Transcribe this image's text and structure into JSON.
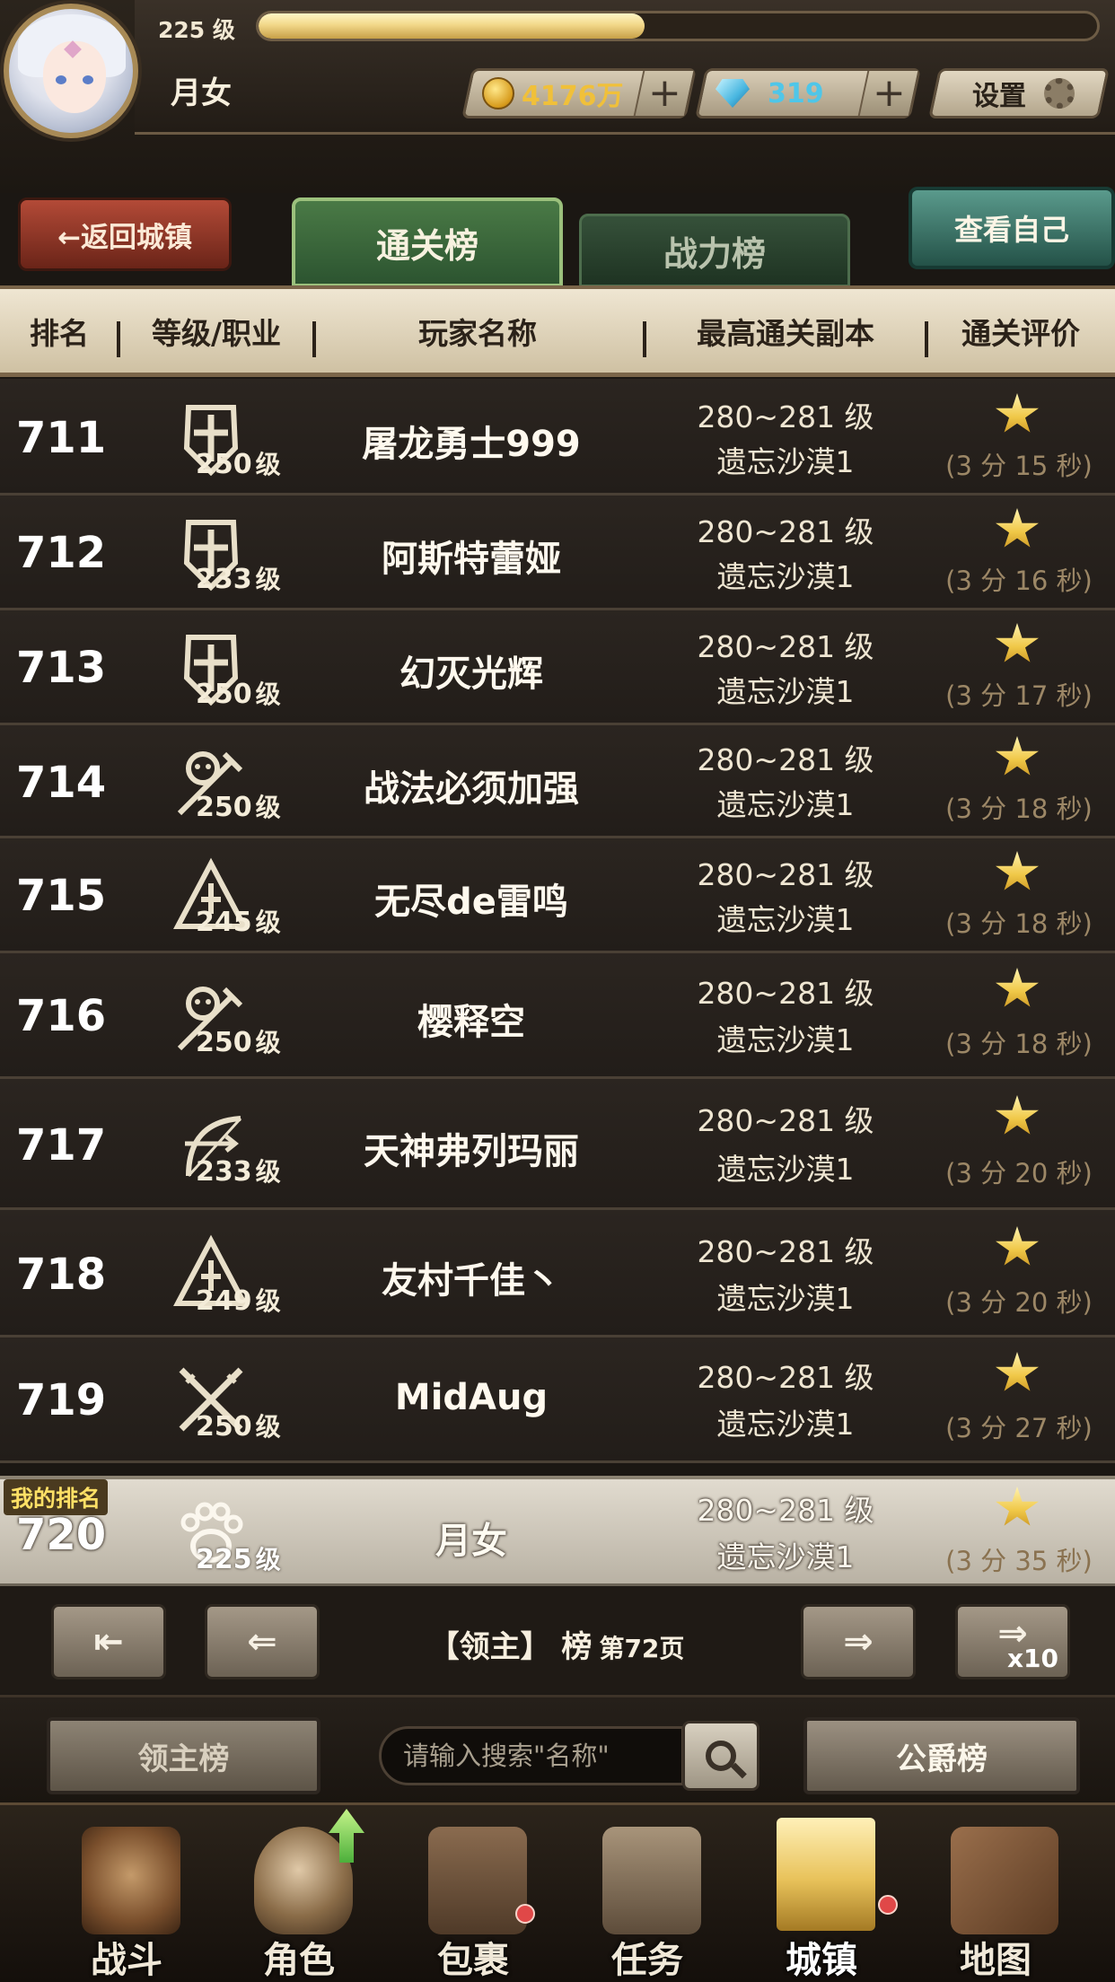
{
  "player": {
    "level_label": "225 级",
    "name": "月女",
    "exp_fraction": 0.46
  },
  "currency": {
    "gold": "4176万",
    "diamonds": "319"
  },
  "settings_label": "设置",
  "tabs": {
    "back": "←返回城镇",
    "clear_board": "通关榜",
    "power_board": "战力榜",
    "view_self": "查看自己"
  },
  "columns": {
    "rank": "排名",
    "level_class": "等级/职业",
    "player_name": "玩家名称",
    "best_stage": "最高通关副本",
    "rating": "通关评价"
  },
  "rows": [
    {
      "rank": "711",
      "class_icon": "shield-cross-icon",
      "level": "250",
      "level_unit": "级",
      "name": "屠龙勇士999",
      "stage_range": "280~281 级",
      "stage_name": "遗忘沙漠1",
      "time": "(3 分 15 秒)"
    },
    {
      "rank": "712",
      "class_icon": "shield-cross-icon",
      "level": "233",
      "level_unit": "级",
      "name": "阿斯特蕾娅",
      "stage_range": "280~281 级",
      "stage_name": "遗忘沙漠1",
      "time": "(3 分 16 秒)"
    },
    {
      "rank": "713",
      "class_icon": "shield-cross-icon",
      "level": "250",
      "level_unit": "级",
      "name": "幻灭光辉",
      "stage_range": "280~281 级",
      "stage_name": "遗忘沙漠1",
      "time": "(3 分 17 秒)"
    },
    {
      "rank": "714",
      "class_icon": "skull-staff-icon",
      "level": "250",
      "level_unit": "级",
      "name": "战法必须加强",
      "stage_range": "280~281 级",
      "stage_name": "遗忘沙漠1",
      "time": "(3 分 18 秒)"
    },
    {
      "rank": "715",
      "class_icon": "rune-triangle-icon",
      "level": "245",
      "level_unit": "级",
      "name": "无尽de雷鸣",
      "stage_range": "280~281 级",
      "stage_name": "遗忘沙漠1",
      "time": "(3 分 18 秒)"
    },
    {
      "rank": "716",
      "class_icon": "skull-staff-icon",
      "level": "250",
      "level_unit": "级",
      "name": "樱释空",
      "stage_range": "280~281 级",
      "stage_name": "遗忘沙漠1",
      "time": "(3 分 18 秒)"
    },
    {
      "rank": "717",
      "class_icon": "bow-icon",
      "level": "233",
      "level_unit": "级",
      "name": "天神弗列玛丽",
      "stage_range": "280~281 级",
      "stage_name": "遗忘沙漠1",
      "time": "(3 分 20 秒)"
    },
    {
      "rank": "718",
      "class_icon": "rune-triangle-icon",
      "level": "249",
      "level_unit": "级",
      "name": "友村千佳丶",
      "stage_range": "280~281 级",
      "stage_name": "遗忘沙漠1",
      "time": "(3 分 20 秒)"
    },
    {
      "rank": "719",
      "class_icon": "crossed-daggers-icon",
      "level": "250",
      "level_unit": "级",
      "name": "MidAug",
      "stage_range": "280~281 级",
      "stage_name": "遗忘沙漠1",
      "time": "(3 分 27 秒)"
    }
  ],
  "my_row": {
    "tag": "我的排名",
    "rank": "720",
    "class_icon": "paw-print-icon",
    "level": "225",
    "level_unit": "级",
    "name": "月女",
    "stage_range": "280~281 级",
    "stage_name": "遗忘沙漠1",
    "time": "(3 分 35 秒)"
  },
  "pager": {
    "title": "【领主】 榜",
    "page": "第72页",
    "jump_label": "x10"
  },
  "search": {
    "lord_board": "领主榜",
    "placeholder": "请输入搜索\"名称\"",
    "duke_board": "公爵榜"
  },
  "nav": [
    {
      "label": "战斗",
      "icon": "shield-swords-icon"
    },
    {
      "label": "角色",
      "icon": "helmet-icon"
    },
    {
      "label": "包裹",
      "icon": "backpack-icon"
    },
    {
      "label": "任务",
      "icon": "scroll-quill-icon"
    },
    {
      "label": "城镇",
      "icon": "castle-tower-icon"
    },
    {
      "label": "地图",
      "icon": "map-icon"
    }
  ],
  "colors": {
    "tab_active": "#4a7a46",
    "back_button": "#b34a37",
    "view_self_button": "#5a9a8c",
    "gold_text": "#f0c03a",
    "diamond_text": "#4fc6e8",
    "star": "#f0c848",
    "badge": "#e04848"
  }
}
